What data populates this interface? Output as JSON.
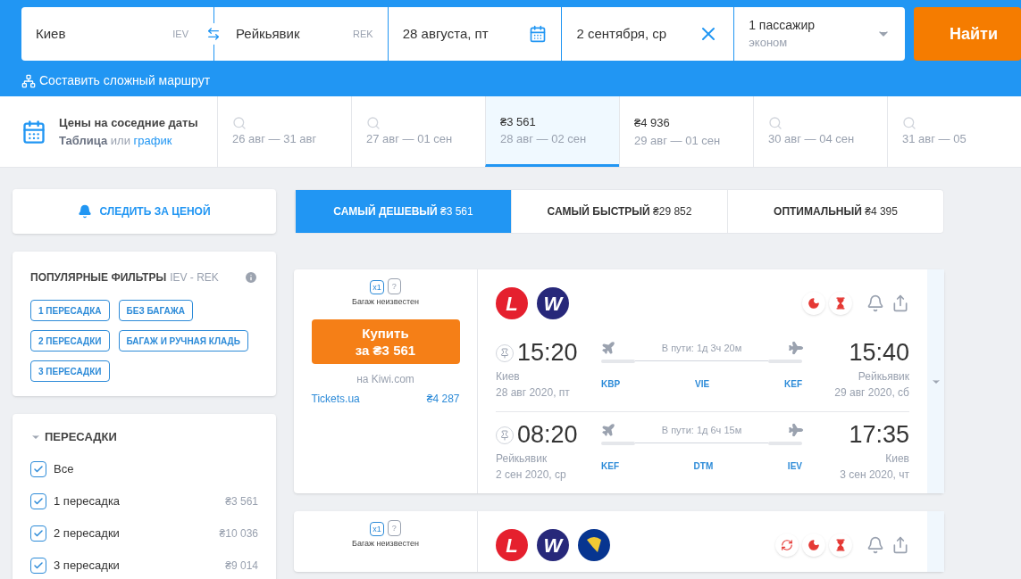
{
  "search": {
    "origin": {
      "city": "Киев",
      "code": "IEV"
    },
    "destination": {
      "city": "Рейкьявик",
      "code": "REK"
    },
    "depart_date": "28 августа, пт",
    "return_date": "2 сентября, ср",
    "passengers": "1 пассажир",
    "cabin": "эконом",
    "find_button": "Найти",
    "complex_route": "Составить сложный маршрут"
  },
  "nearby_dates": {
    "title": "Цены на соседние даты",
    "table_link": "Таблица",
    "or": "или",
    "chart_link": "график",
    "items": [
      {
        "range": "26 авг — 31 авг",
        "selected": false
      },
      {
        "range": "27 авг — 01 сен",
        "selected": false
      },
      {
        "price": "₴3 561",
        "range": "28 авг — 02 сен",
        "selected": true
      },
      {
        "price": "₴4 936",
        "range": "29 авг — 01 сен",
        "selected": false
      },
      {
        "range": "30 авг — 04 сен",
        "selected": false
      },
      {
        "range": "31 авг — 05",
        "selected": false
      }
    ]
  },
  "track_price": "СЛЕДИТЬ ЗА ЦЕНОЙ",
  "popular_filters": {
    "title": "ПОПУЛЯРНЫЕ ФИЛЬТРЫ",
    "route": "IEV - REK",
    "chips": [
      "1 ПЕРЕСАДКА",
      "БЕЗ БАГАЖА",
      "2 ПЕРЕСАДКИ",
      "БАГАЖ И РУЧНАЯ КЛАДЬ",
      "3 ПЕРЕСАДКИ"
    ]
  },
  "transfers": {
    "title": "ПЕРЕСАДКИ",
    "expanded": true,
    "options": [
      {
        "label": "Все",
        "checked": true
      },
      {
        "label": "1 пересадка",
        "price": "₴3 561",
        "checked": true
      },
      {
        "label": "2 пересадки",
        "price": "₴10 036",
        "checked": true
      },
      {
        "label": "3 пересадки",
        "price": "₴9 014",
        "checked": true
      }
    ]
  },
  "sort_tabs": [
    {
      "label": "САМЫЙ ДЕШЕВЫЙ",
      "price": "₴3 561",
      "selected": true
    },
    {
      "label": "САМЫЙ БЫСТРЫЙ",
      "price": "₴29 852",
      "selected": false
    },
    {
      "label": "ОПТИМАЛЬНЫЙ",
      "price": "₴4 395",
      "selected": false
    }
  ],
  "results": [
    {
      "baggage": {
        "hand": "x1",
        "checked": "?",
        "note": "Багаж неизвестен"
      },
      "buy": {
        "line1": "Купить",
        "line2": "за ₴3 561"
      },
      "agency": "на Kiwi.com",
      "alt_offer": {
        "name": "Tickets.ua",
        "price": "₴4 287"
      },
      "airlines": [
        {
          "kind": "letter",
          "mark": "L",
          "color": "#e5202e"
        },
        {
          "kind": "letter",
          "mark": "W",
          "color": "#27287a"
        }
      ],
      "badges": [
        {
          "kind": "night"
        },
        {
          "kind": "long"
        }
      ],
      "legs": [
        {
          "dep_time": "15:20",
          "dep_city": "Киев",
          "dep_date": "28 авг 2020, пт",
          "duration": "В пути: 1д 3ч 20м",
          "airports": [
            "KBP",
            "VIE",
            "KEF"
          ],
          "arr_time": "15:40",
          "arr_city": "Рейкьявик",
          "arr_date": "29 авг 2020, сб"
        },
        {
          "dep_time": "08:20",
          "dep_city": "Рейкьявик",
          "dep_date": "2 сен 2020, ср",
          "duration": "В пути: 1д 6ч 15м",
          "airports": [
            "KEF",
            "DTM",
            "IEV"
          ],
          "arr_time": "17:35",
          "arr_city": "Киев",
          "arr_date": "3 сен 2020, чт"
        }
      ]
    },
    {
      "baggage": {
        "hand": "x1",
        "checked": "?",
        "note": "Багаж неизвестен"
      },
      "airlines": [
        {
          "kind": "letter",
          "mark": "L",
          "color": "#e5202e"
        },
        {
          "kind": "letter",
          "mark": "W",
          "color": "#27287a"
        },
        {
          "kind": "harp",
          "color": "#073590"
        }
      ],
      "badges": [
        {
          "kind": "transfer"
        },
        {
          "kind": "night"
        },
        {
          "kind": "long"
        }
      ]
    }
  ]
}
